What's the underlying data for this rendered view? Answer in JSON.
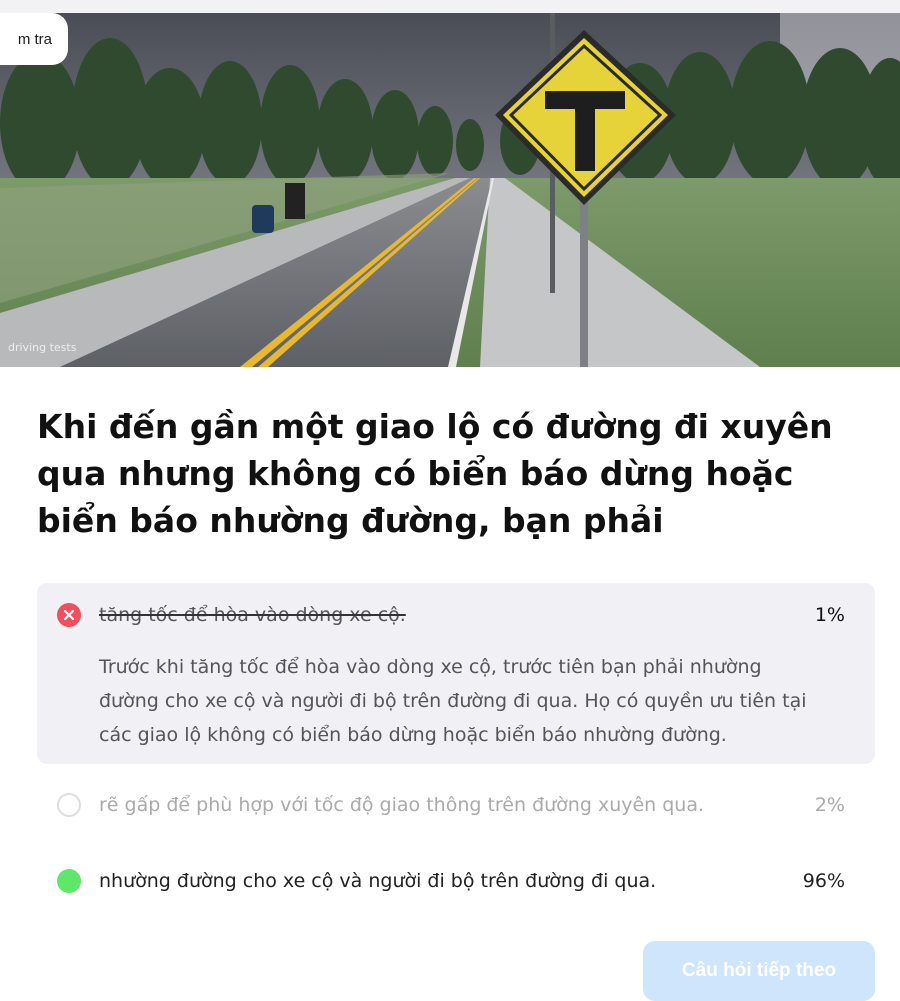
{
  "header": {
    "test_label": "m tra"
  },
  "hero": {
    "watermark": "driving tests",
    "alt": "T-intersection road sign"
  },
  "question": {
    "text": "Khi đến gần một giao lộ có đường đi xuyên qua nhưng không có biển báo dừng hoặc biển báo nhường đường, bạn phải"
  },
  "answers": [
    {
      "text": "tăng tốc để hòa vào dòng xe cộ.",
      "percent": "1%",
      "state": "incorrect-selected",
      "explanation": "Trước khi tăng tốc để hòa vào dòng xe cộ, trước tiên bạn phải nhường đường cho xe cộ và người đi bộ trên đường đi qua. Họ có quyền ưu tiên tại các giao lộ không có biển báo dừng hoặc biển báo nhường đường."
    },
    {
      "text": "rẽ gấp để phù hợp với tốc độ giao thông trên đường xuyên qua.",
      "percent": "2%",
      "state": "unselected"
    },
    {
      "text": "nhường đường cho xe cộ và người đi bộ trên đường đi qua.",
      "percent": "96%",
      "state": "correct"
    }
  ],
  "next_button": {
    "label": "Câu hỏi tiếp theo"
  },
  "colors": {
    "incorrect": "#ef4f5f",
    "correct": "#5ee86a",
    "panel": "#f0f0f5",
    "button": "#cfe5fb"
  }
}
